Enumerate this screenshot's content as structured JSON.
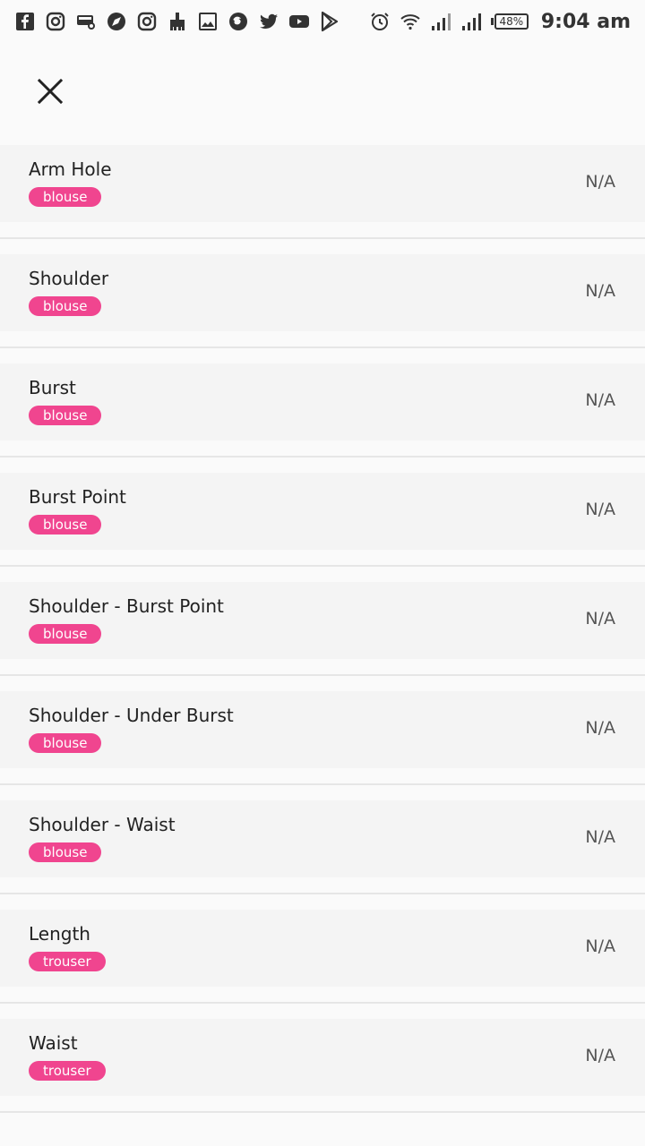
{
  "status_bar": {
    "battery": "48%",
    "time": "9:04 am",
    "left_icons": [
      "facebook-icon",
      "instagram-icon",
      "bus-icon",
      "compass-icon",
      "instagram-icon",
      "brush-icon",
      "image-icon",
      "firefox-icon",
      "twitter-icon",
      "youtube-icon",
      "play-store-icon"
    ],
    "right_icons": [
      "alarm-icon",
      "wifi-icon",
      "signal-icon",
      "signal-icon"
    ]
  },
  "header": {
    "close_icon": "close-icon"
  },
  "measurements": [
    {
      "name": "Arm Hole",
      "tag": "blouse",
      "value": "N/A"
    },
    {
      "name": "Shoulder",
      "tag": "blouse",
      "value": "N/A"
    },
    {
      "name": "Burst",
      "tag": "blouse",
      "value": "N/A"
    },
    {
      "name": "Burst Point",
      "tag": "blouse",
      "value": "N/A"
    },
    {
      "name": "Shoulder - Burst Point",
      "tag": "blouse",
      "value": "N/A"
    },
    {
      "name": "Shoulder - Under Burst",
      "tag": "blouse",
      "value": "N/A"
    },
    {
      "name": "Shoulder - Waist",
      "tag": "blouse",
      "value": "N/A"
    },
    {
      "name": "Length",
      "tag": "trouser",
      "value": "N/A"
    },
    {
      "name": "Waist",
      "tag": "trouser",
      "value": "N/A"
    }
  ],
  "colors": {
    "tag_background": "#f0458f",
    "row_background": "#f4f4f4",
    "divider": "#e6e6e6"
  }
}
